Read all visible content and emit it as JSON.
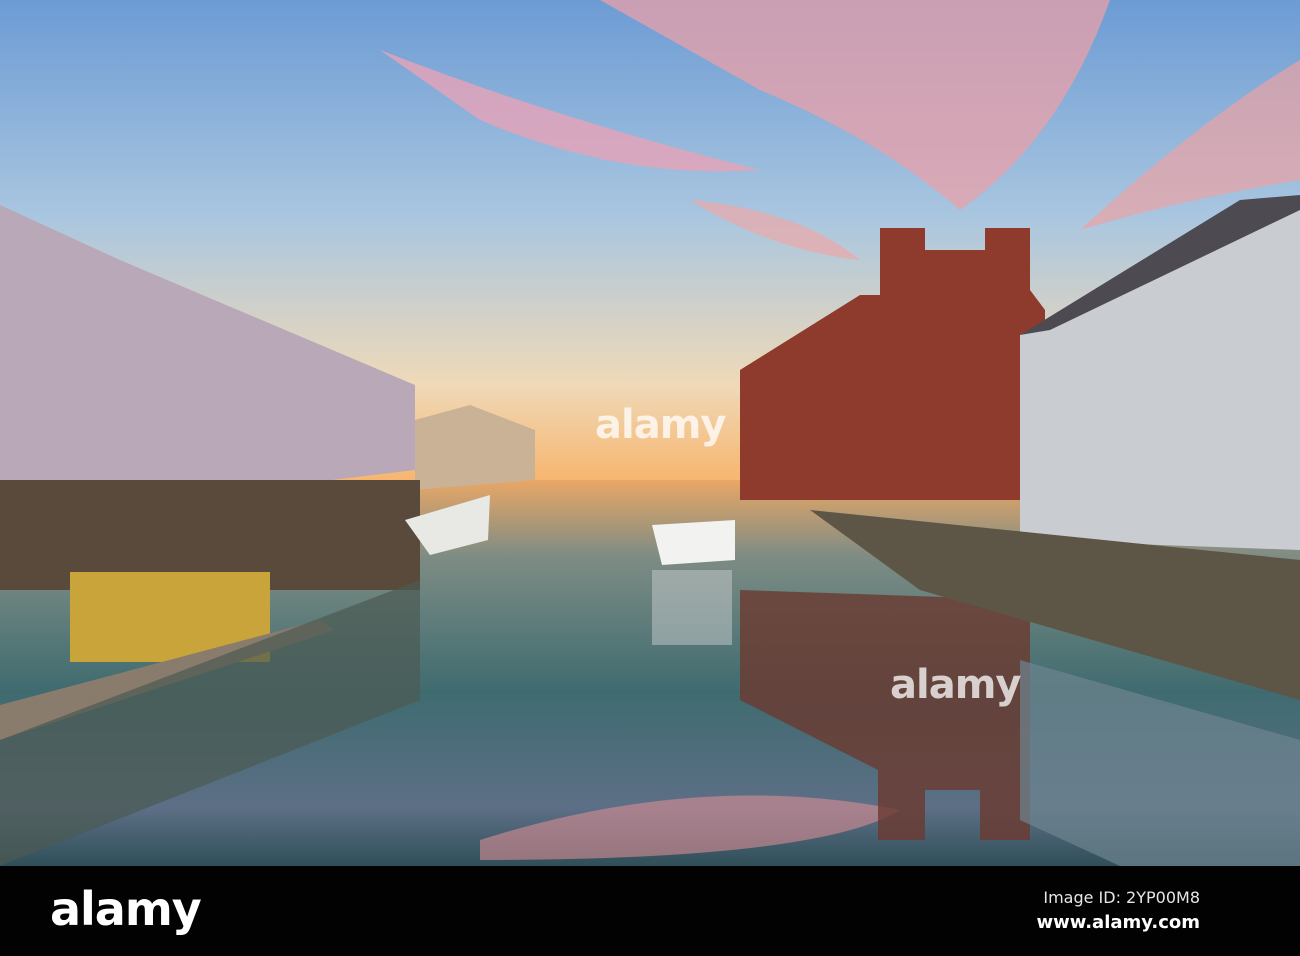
{
  "watermark": {
    "text": "alamy"
  },
  "footer": {
    "logo": "alamy",
    "image_id": "Image ID: 2YP00M8",
    "url": "www.alamy.com"
  },
  "colors": {
    "sky_top": "#6c9bd4",
    "horizon": "#f7c37e",
    "brick": "#8e3a2c",
    "water": "#3e6a6e",
    "footer": "#020202"
  }
}
